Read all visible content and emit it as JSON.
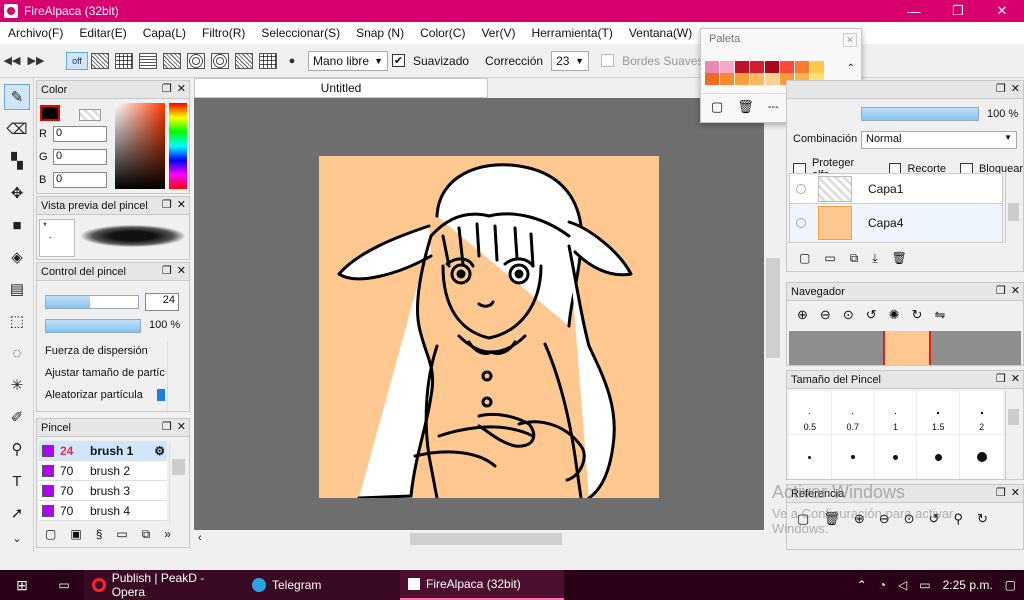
{
  "window": {
    "title": "FireAlpaca (32bit)",
    "min": "—",
    "restore": "❐",
    "close": "✕"
  },
  "menu": [
    "Archivo(F)",
    "Editar(E)",
    "Capa(L)",
    "Filtro(R)",
    "Seleccionar(S)",
    "Snap (N)",
    "Color(C)",
    "Ver(V)",
    "Herramienta(T)",
    "Ventana(W)",
    "He"
  ],
  "toolbar": {
    "off_label": "off",
    "brush_mode": "Mano libre",
    "smoothing_label": "Suavizado",
    "correction_label": "Corrección",
    "correction_value": "23",
    "soft_edges_label": "Bordes Suaves"
  },
  "tab": {
    "title": "Untitled"
  },
  "color_panel": {
    "title": "Color",
    "r_label": "R",
    "g_label": "G",
    "b_label": "B",
    "r": "0",
    "g": "0",
    "b": "0"
  },
  "brush_preview": {
    "title": "Vista previa del pincel"
  },
  "brush_control": {
    "title": "Control del pincel",
    "size_value": "24",
    "opacity_value": "100 %",
    "scatter_label": "Fuerza de dispersión",
    "particle_size_label": "Ajustar tamaño de partíc",
    "randomize_label": "Aleatorizar partícula"
  },
  "brush_panel": {
    "title": "Pincel",
    "items": [
      {
        "size": "24",
        "name": "brush 1"
      },
      {
        "size": "70",
        "name": "brush 2"
      },
      {
        "size": "70",
        "name": "brush 3"
      },
      {
        "size": "70",
        "name": "brush 4"
      }
    ]
  },
  "palette": {
    "title": "Paleta",
    "none_label": "---"
  },
  "layer_panel": {
    "opacity": "100 %",
    "blend_label": "Combinación",
    "blend_value": "Normal",
    "protect_alpha": "Proteger alfa",
    "clipping": "Recorte",
    "lock": "Bloquear",
    "layers": [
      "Capa1",
      "Capa4"
    ]
  },
  "navigator": {
    "title": "Navegador"
  },
  "brush_size_panel": {
    "title": "Tamaño del Pincel",
    "sizes": [
      "0.5",
      "0.7",
      "1",
      "1.5",
      "2"
    ]
  },
  "reference": {
    "title": "Referencia"
  },
  "watermark": {
    "line1": "Activar Windows",
    "line2": "Ve a Configuración para activar Windows."
  },
  "taskbar": {
    "opera": "Publish | PeakD - Opera",
    "telegram": "Telegram",
    "firealpaca": "FireAlpaca (32bit)",
    "time": "2:25 p.m."
  },
  "colors": {
    "accent": "#d8006e",
    "canvas_bg": "#ffc890",
    "brush_swatch": "#b200ff"
  }
}
